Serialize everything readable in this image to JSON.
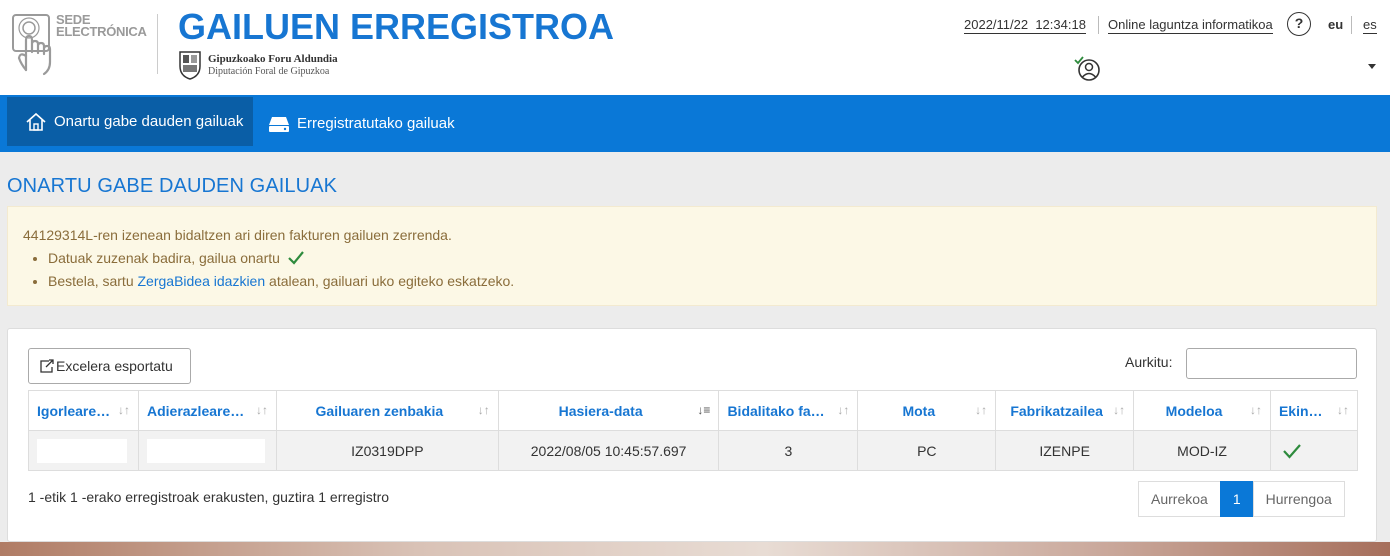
{
  "header": {
    "sede_line1": "SEDE",
    "sede_line2": "ELECTRÓNICA",
    "app_title": "GAILUEN ERREGISTROA",
    "org_eu": "Gipuzkoako Foru Aldundia",
    "org_es": "Diputación Foral de Gipuzkoa",
    "datetime": "2022/11/22  12:34:18",
    "online_help": "Online laguntza informatikoa",
    "help_symbol": "?",
    "lang_eu": "eu",
    "lang_es": "es",
    "icons": [
      "hand-touch-icon",
      "shield-icon",
      "help-icon",
      "user-check-icon",
      "caret-down-icon"
    ]
  },
  "nav": {
    "items": [
      {
        "label": "Onartu gabe dauden gailuak",
        "icon": "home-icon",
        "active": true
      },
      {
        "label": "Erregistratutako gailuak",
        "icon": "drive-icon",
        "active": false
      }
    ]
  },
  "page": {
    "title": "ONARTU GABE DAUDEN GAILUAK"
  },
  "info": {
    "line": "44129314L-ren izenean bidaltzen ari diren fakturen gailuen zerrenda.",
    "bullet1": "Datuak zuzenak badira, gailua onartu",
    "bullet2_pre": "Bestela, sartu ",
    "bullet2_link": "ZergaBidea idazkien",
    "bullet2_post": " atalean, gailuari uko egiteko eskatzeko."
  },
  "table": {
    "export_label": "Excelera esportatu",
    "search_label": "Aurkitu:",
    "search_value": "",
    "columns": [
      "Igorleare…",
      "Adierazleare…",
      "Gailuaren zenbakia",
      "Hasiera-data",
      "Bidalitako fa…",
      "Mota",
      "Fabrikatzailea",
      "Modeloa",
      "Ekin…"
    ],
    "sorted_column": "Hasiera-data",
    "rows": [
      {
        "igorlea": "",
        "adierazlea": "",
        "zenbakia": "IZ0319DPP",
        "hasiera_data": "2022/08/05 10:45:57.697",
        "bidalitako": "3",
        "mota": "PC",
        "fabrikatzailea": "IZENPE",
        "modeloa": "MOD-IZ",
        "ekintza": "check-icon"
      }
    ],
    "info_text": "1 -etik 1 -erako erregistroak erakusten, guztira 1 erregistro",
    "pager": {
      "prev": "Aurrekoa",
      "current": "1",
      "next": "Hurrengoa"
    }
  },
  "colors": {
    "brand_blue": "#1776d2",
    "nav_blue": "#0a78d7",
    "nav_active": "#0a5ea6",
    "info_bg": "#fcf8e6",
    "info_text": "#8a6d3b",
    "check_green": "#2e8b3d"
  }
}
